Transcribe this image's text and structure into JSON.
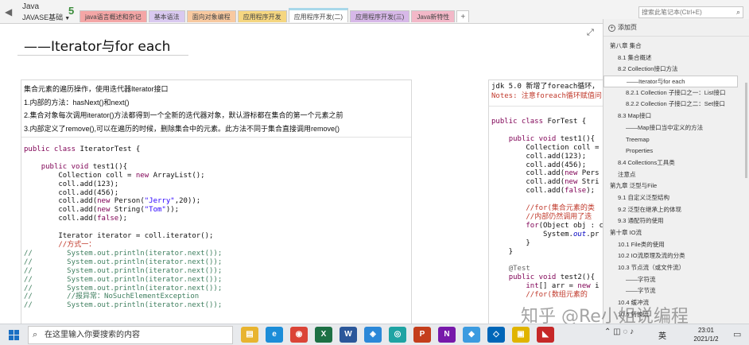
{
  "notebook": {
    "title": "Java",
    "section_group": "JAVASE基础",
    "count": "5"
  },
  "tabs": [
    {
      "label": "java语言概述和杂记",
      "color": "#f4a6a6",
      "active": false
    },
    {
      "label": "基本语法",
      "color": "#d9c9f0",
      "active": false
    },
    {
      "label": "面向对象编程",
      "color": "#f8c9a0",
      "active": false
    },
    {
      "label": "应用程序开发",
      "color": "#f5d680",
      "active": false
    },
    {
      "label": "应用程序开发(二)",
      "color": "#a8d8ea",
      "active": true
    },
    {
      "label": "应用程序开发(三)",
      "color": "#d7b8e8",
      "active": false
    },
    {
      "label": "Java新特性",
      "color": "#f3b8c8",
      "active": false
    },
    {
      "label": "+",
      "color": "#ffffff",
      "active": false
    }
  ],
  "search": {
    "placeholder": "搜索此笔记本(Ctrl+E)"
  },
  "page": {
    "title": "——Iterator与for each",
    "note1": {
      "lines": [
        "集合元素的遍历操作，使用迭代器Iterator接口",
        "1.内部的方法：hasNext()和next()",
        "2.集合对象每次调用iterator()方法都得到一个全新的迭代器对象，默认游标都在集合的第一个元素之前",
        "3.内部定义了remove(),可以在遍历的时候，删除集合中的元素。此方法不同于集合直接调用remove()"
      ]
    },
    "note2": {
      "line1": "jdk 5.0 新增了foreach循环，",
      "line2": "Notes: 注意foreach循环赋值问"
    }
  },
  "sidebar": {
    "add_page": "添加页",
    "pages": [
      {
        "label": "第八章 集合",
        "level": 0,
        "active": false
      },
      {
        "label": "8.1 集合概述",
        "level": 1,
        "active": false
      },
      {
        "label": "8.2 Collection接口方法",
        "level": 1,
        "active": false
      },
      {
        "label": "——Iterator与for each",
        "level": 2,
        "active": true
      },
      {
        "label": "8.2.1 Collection 子接口之一：List接口",
        "level": 2,
        "active": false
      },
      {
        "label": "8.2.2 Collection 子接口之二：Set接口",
        "level": 2,
        "active": false
      },
      {
        "label": "8.3 Map接口",
        "level": 1,
        "active": false
      },
      {
        "label": "——Map接口当中定义的方法",
        "level": 2,
        "active": false
      },
      {
        "label": "Treemap",
        "level": 2,
        "active": false
      },
      {
        "label": "Properties",
        "level": 2,
        "active": false
      },
      {
        "label": "8.4 Collections工具类",
        "level": 1,
        "active": false
      },
      {
        "label": "注意点",
        "level": 1,
        "active": false
      },
      {
        "label": "第九章 泛型与File",
        "level": 0,
        "active": false
      },
      {
        "label": "9.1 自定义泛型结构",
        "level": 1,
        "active": false
      },
      {
        "label": "9.2 泛型在继承上的体现",
        "level": 1,
        "active": false
      },
      {
        "label": "9.3 通配符的使用",
        "level": 1,
        "active": false
      },
      {
        "label": "第十章 IO流",
        "level": 0,
        "active": false
      },
      {
        "label": "10.1 File类的使用",
        "level": 1,
        "active": false
      },
      {
        "label": "10.2 IO流原理及流的分类",
        "level": 1,
        "active": false
      },
      {
        "label": "10.3 节点流（或文件流）",
        "level": 1,
        "active": false
      },
      {
        "label": "——字符流",
        "level": 2,
        "active": false
      },
      {
        "label": "——字节流",
        "level": 2,
        "active": false
      },
      {
        "label": "10.4 缓冲流",
        "level": 1,
        "active": false
      },
      {
        "label": "10.5 转换流",
        "level": 1,
        "active": false
      }
    ]
  },
  "taskbar": {
    "search_placeholder": "在这里输入你要搜索的内容",
    "apps": [
      {
        "name": "file-explorer-icon",
        "color": "#e8b430",
        "glyph": "▤"
      },
      {
        "name": "edge-icon",
        "color": "#1c8dd8",
        "glyph": "e"
      },
      {
        "name": "chrome-icon",
        "color": "#db4437",
        "glyph": "◉"
      },
      {
        "name": "excel-icon",
        "color": "#1d7044",
        "glyph": "X"
      },
      {
        "name": "word-icon",
        "color": "#2b579a",
        "glyph": "W"
      },
      {
        "name": "app-icon-blue",
        "color": "#2b88d8",
        "glyph": "◈"
      },
      {
        "name": "app-icon-cyan",
        "color": "#1fa3a3",
        "glyph": "◎"
      },
      {
        "name": "powerpoint-icon",
        "color": "#c43e1c",
        "glyph": "P"
      },
      {
        "name": "onenote-icon",
        "color": "#7719aa",
        "glyph": "N"
      },
      {
        "name": "app-icon-sky",
        "color": "#3b9be0",
        "glyph": "◆"
      },
      {
        "name": "vscode-icon",
        "color": "#0066b8",
        "glyph": "◇"
      },
      {
        "name": "app-icon-yellow",
        "color": "#e0b400",
        "glyph": "▣"
      },
      {
        "name": "app-icon-red",
        "color": "#c62828",
        "glyph": "◣"
      }
    ],
    "lang": "英",
    "time": "23:01",
    "date": "2021/1/2"
  },
  "watermark": "知乎 @Re小姐说编程"
}
